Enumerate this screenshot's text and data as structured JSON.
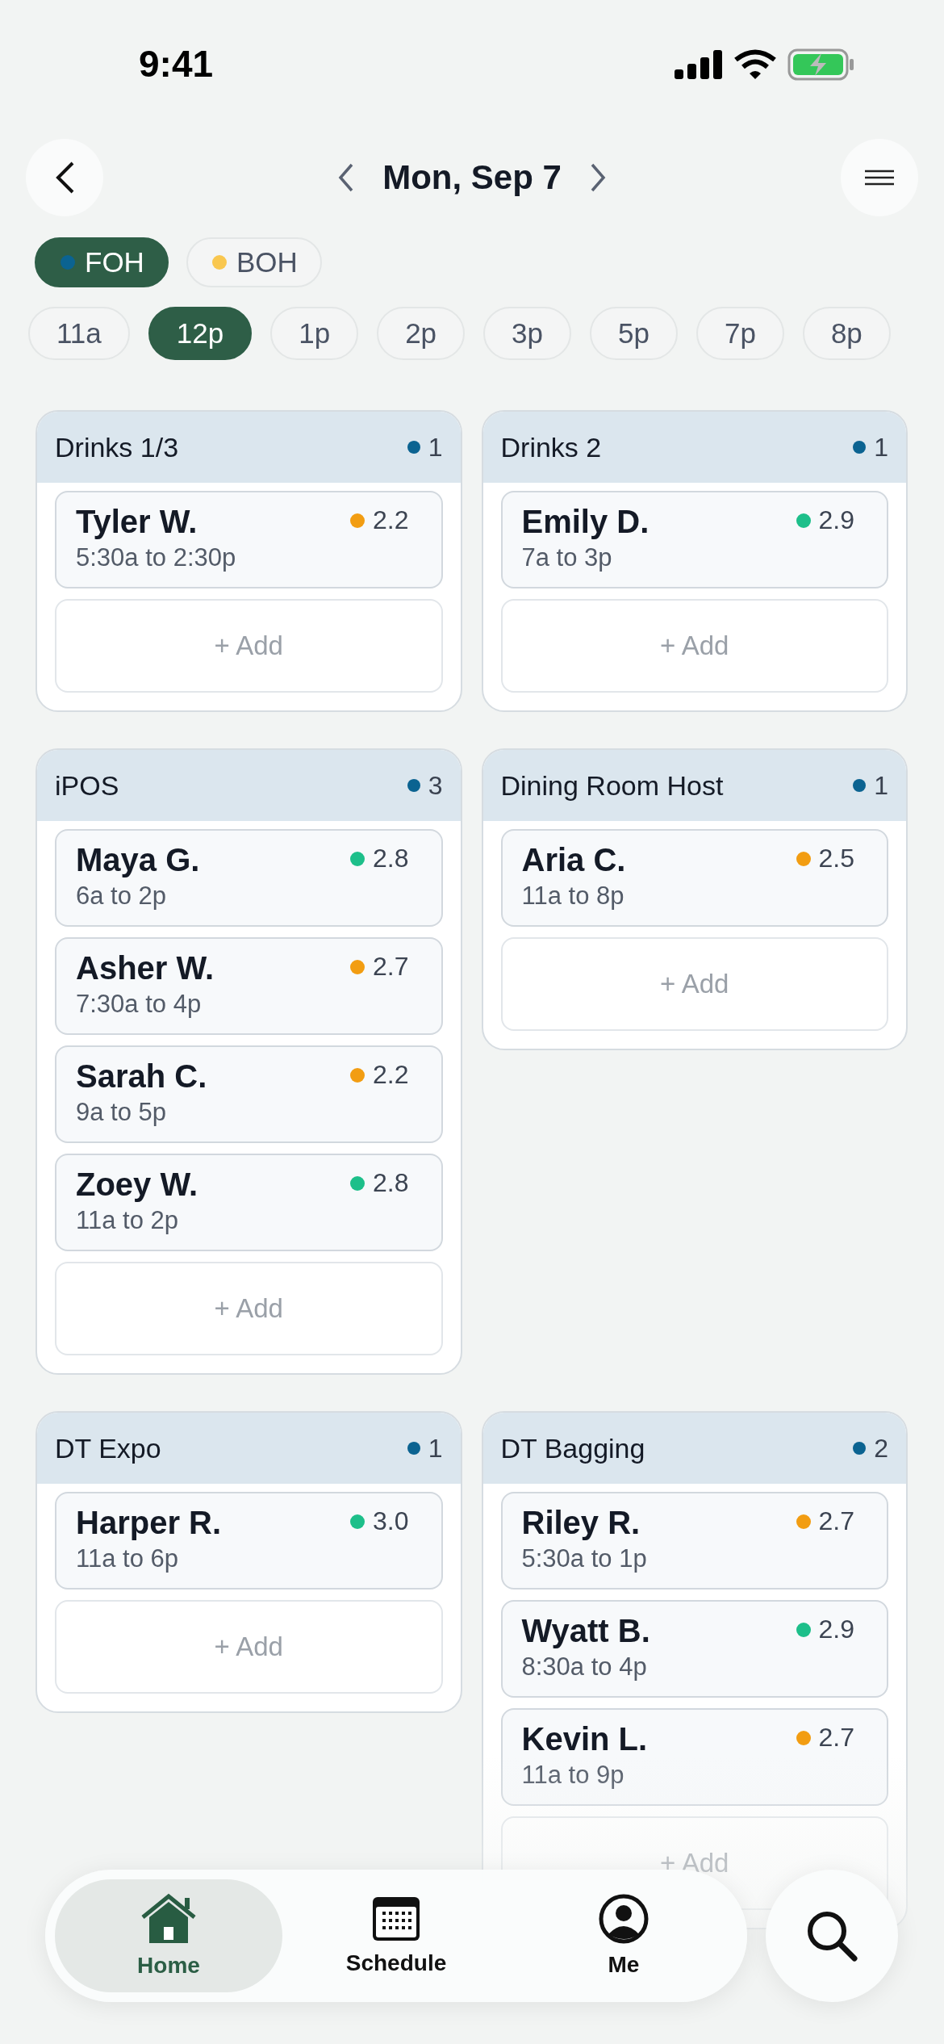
{
  "status_bar": {
    "time": "9:41"
  },
  "header": {
    "date": "Mon, Sep 7"
  },
  "filters": [
    {
      "label": "FOH",
      "selected": true,
      "color": "#0b6391"
    },
    {
      "label": "BOH",
      "selected": false,
      "color": "#f9c74f"
    }
  ],
  "hours": [
    {
      "label": "11a",
      "selected": false
    },
    {
      "label": "12p",
      "selected": true
    },
    {
      "label": "1p",
      "selected": false
    },
    {
      "label": "2p",
      "selected": false
    },
    {
      "label": "3p",
      "selected": false
    },
    {
      "label": "5p",
      "selected": false
    },
    {
      "label": "7p",
      "selected": false
    },
    {
      "label": "8p",
      "selected": false
    }
  ],
  "positions": [
    {
      "title": "Drinks 1/3",
      "count": "1",
      "shifts": [
        {
          "name": "Tyler W.",
          "time": "5:30a to 2:30p",
          "rating": "2.2",
          "color": "#f29d12"
        }
      ],
      "add": "+ Add"
    },
    {
      "title": "Drinks 2",
      "count": "1",
      "shifts": [
        {
          "name": "Emily D.",
          "time": "7a to 3p",
          "rating": "2.9",
          "color": "#1dbf8a"
        }
      ],
      "add": "+ Add"
    },
    {
      "title": "iPOS",
      "count": "3",
      "shifts": [
        {
          "name": "Maya G.",
          "time": "6a to 2p",
          "rating": "2.8",
          "color": "#1dbf8a"
        },
        {
          "name": "Asher W.",
          "time": "7:30a to 4p",
          "rating": "2.7",
          "color": "#f29d12"
        },
        {
          "name": "Sarah C.",
          "time": "9a to 5p",
          "rating": "2.2",
          "color": "#f29d12"
        },
        {
          "name": "Zoey W.",
          "time": "11a to 2p",
          "rating": "2.8",
          "color": "#1dbf8a"
        }
      ],
      "add": "+ Add"
    },
    {
      "title": "Dining Room Host",
      "count": "1",
      "shifts": [
        {
          "name": "Aria C.",
          "time": "11a to 8p",
          "rating": "2.5",
          "color": "#f29d12"
        }
      ],
      "add": "+ Add"
    },
    {
      "title": "DT Expo",
      "count": "1",
      "shifts": [
        {
          "name": "Harper R.",
          "time": "11a to 6p",
          "rating": "3.0",
          "color": "#1dbf8a"
        }
      ],
      "add": "+ Add"
    },
    {
      "title": "DT Bagging",
      "count": "2",
      "shifts": [
        {
          "name": "Riley R.",
          "time": "5:30a to 1p",
          "rating": "2.7",
          "color": "#f29d12"
        },
        {
          "name": "Wyatt B.",
          "time": "8:30a to 4p",
          "rating": "2.9",
          "color": "#1dbf8a"
        },
        {
          "name": "Kevin L.",
          "time": "11a to 9p",
          "rating": "2.7",
          "color": "#f29d12"
        }
      ],
      "add": "+ Add"
    }
  ],
  "tab_bar": [
    {
      "kind": "home",
      "label": "Home",
      "selected": true
    },
    {
      "kind": "schedule",
      "label": "Schedule",
      "selected": false
    },
    {
      "kind": "me",
      "label": "Me",
      "selected": false
    }
  ]
}
